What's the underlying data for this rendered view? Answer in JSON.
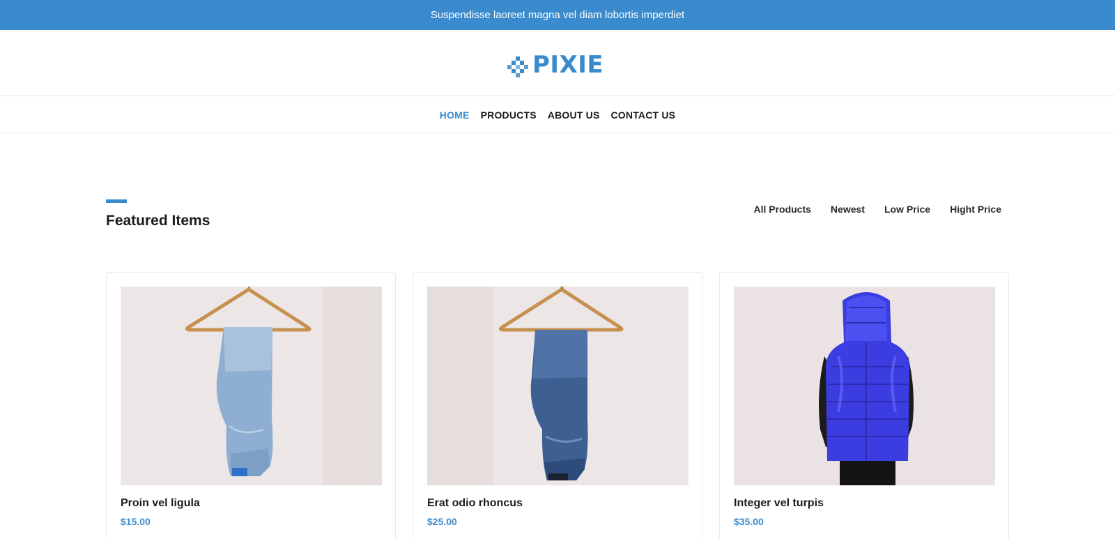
{
  "announcement": "Suspendisse laoreet magna vel diam lobortis imperdiet",
  "brand": {
    "name": "PIXIE",
    "logo_icon": "pixel-diamond-icon",
    "accent_color": "#3a8bcd"
  },
  "nav": [
    {
      "label": "HOME",
      "active": true
    },
    {
      "label": "PRODUCTS",
      "active": false
    },
    {
      "label": "ABOUT US",
      "active": false
    },
    {
      "label": "CONTACT US",
      "active": false
    }
  ],
  "featured": {
    "title": "Featured Items",
    "filters": [
      "All Products",
      "Newest",
      "Low Price",
      "Hight Price"
    ],
    "products": [
      {
        "name": "Proin vel ligula",
        "price": "$15.00",
        "image": "light-blue-jeans-on-hanger"
      },
      {
        "name": "Erat odio rhoncus",
        "price": "$25.00",
        "image": "dark-blue-jeans-on-hanger"
      },
      {
        "name": "Integer vel turpis",
        "price": "$35.00",
        "image": "blue-puffer-vest-back-view"
      }
    ]
  }
}
